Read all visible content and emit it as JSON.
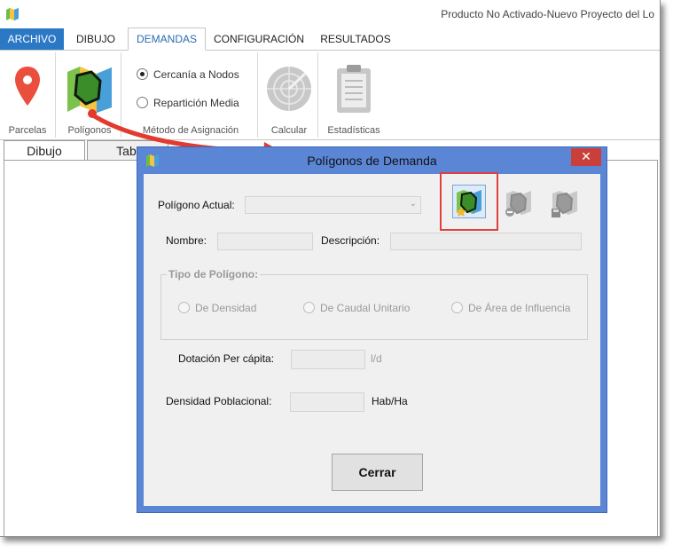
{
  "app": {
    "title": "Producto No Activado-Nuevo Proyecto del Lo"
  },
  "ribbon_tabs": [
    {
      "label": "ARCHIVO"
    },
    {
      "label": "DIBUJO"
    },
    {
      "label": "DEMANDAS"
    },
    {
      "label": "CONFIGURACIÓN"
    },
    {
      "label": "RESULTADOS"
    }
  ],
  "ribbon": {
    "parcelas_label": "Parcelas",
    "poligonos_label": "Polígonos",
    "radio_cercania": "Cercanía a Nodos",
    "radio_reparticion": "Repartición Media",
    "metodo_label": "Método de Asignación",
    "calcular_label": "Calcular",
    "estadisticas_label": "Estadísticas"
  },
  "doc_tabs": [
    {
      "label": "Dibujo"
    },
    {
      "label": "Tabl"
    }
  ],
  "dialog": {
    "title": "Polígonos de Demanda",
    "close_glyph": "✕",
    "poligono_actual_label": "Polígono Actual:",
    "nombre_label": "Nombre:",
    "descripcion_label": "Descripción:",
    "tipo_label": "Tipo de Polígono:",
    "tipo_options": [
      "De Densidad",
      "De Caudal Unitario",
      "De Área de Influencia"
    ],
    "dotacion_label": "Dotación Per cápita:",
    "dotacion_unit": "l/d",
    "densidad_label": "Densidad Poblacional:",
    "densidad_unit": "Hab/Ha",
    "cerrar_label": "Cerrar"
  },
  "colors": {
    "file_tab": "#2b78c5",
    "dialog_frame": "#5b86d6",
    "close_button": "#c9403a",
    "highlight": "#e04040"
  }
}
